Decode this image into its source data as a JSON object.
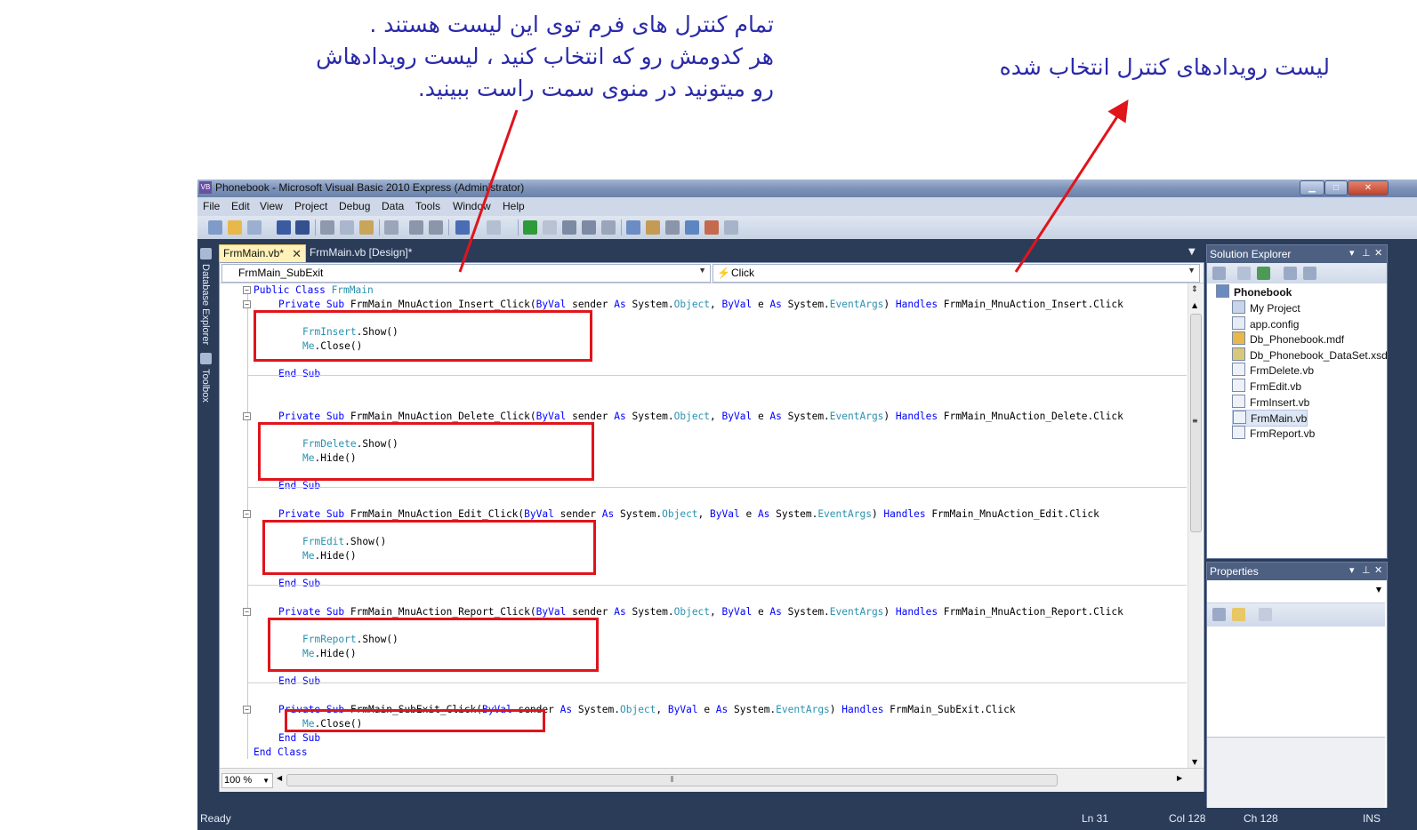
{
  "annotations": {
    "left_line1": "تمام کنترل های فرم توی این لیست هستند .",
    "left_line2": "هر کدومش رو که انتخاب کنید ، لیست رویدادهاش",
    "left_line3": "رو میتونید در منوی سمت راست ببینید.",
    "right_text": "لیست رویدادهای کنترل انتخاب شده"
  },
  "window": {
    "icon": "VB",
    "title": "Phonebook - Microsoft Visual Basic 2010 Express (Administrator)"
  },
  "menu": [
    "File",
    "Edit",
    "View",
    "Project",
    "Debug",
    "Data",
    "Tools",
    "Window",
    "Help"
  ],
  "left_tabs": {
    "database_explorer": "Database Explorer",
    "toolbox": "Toolbox"
  },
  "tabs": [
    {
      "label": "FrmMain.vb*",
      "close": "✕"
    },
    {
      "label": "FrmMain.vb [Design]*"
    }
  ],
  "navbar": {
    "object": "FrmMain_SubExit",
    "event": "Click"
  },
  "code": {
    "class_decl": [
      "Public Class ",
      "FrmMain"
    ],
    "end_class": "End Class",
    "end_sub": "End Sub",
    "subs": [
      {
        "kw": "Private Sub ",
        "name": "FrmMain_MnuAction_Insert_Click",
        "handles": "FrmMain_MnuAction_Insert.Click",
        "form": "FrmInsert",
        "action": "Close"
      },
      {
        "kw": "Private Sub ",
        "name": "FrmMain_MnuAction_Delete_Click",
        "handles": "FrmMain_MnuAction_Delete.Click",
        "form": "FrmDelete",
        "action": "Hide"
      },
      {
        "kw": "Private Sub ",
        "name": "FrmMain_MnuAction_Edit_Click",
        "handles": "FrmMain_MnuAction_Edit.Click",
        "form": "FrmEdit",
        "action": "Hide"
      },
      {
        "kw": "Private Sub ",
        "name": "FrmMain_MnuAction_Report_Click",
        "handles": "FrmMain_MnuAction_Report.Click",
        "form": "FrmReport",
        "action": "Hide"
      },
      {
        "kw": "Private Sub ",
        "name": "FrmMain_SubExit_Click",
        "handles": "FrmMain_SubExit.Click",
        "action": "Close"
      }
    ],
    "params": {
      "p1": "(",
      "byval": "ByVal",
      "sender": " sender ",
      "as": "As",
      "system": " System.",
      "object": "Object",
      "comma": ", ",
      "e": " e ",
      "eventargs": "EventArgs",
      "close_paren": ") ",
      "handles": "Handles "
    },
    "show_call": ".Show()",
    "me": "Me",
    "close_call": ".Close()",
    "hide_call": ".Hide()"
  },
  "zoom": "100 %",
  "solution_explorer": {
    "title": "Solution Explorer",
    "project": "Phonebook",
    "items": [
      "My Project",
      "app.config",
      "Db_Phonebook.mdf",
      "Db_Phonebook_DataSet.xsd",
      "FrmDelete.vb",
      "FrmEdit.vb",
      "FrmInsert.vb",
      "FrmMain.vb",
      "FrmReport.vb"
    ],
    "selected": "FrmMain.vb"
  },
  "properties": {
    "title": "Properties"
  },
  "status": {
    "ready": "Ready",
    "ln": "Ln 31",
    "col": "Col 128",
    "ch": "Ch 128",
    "ins": "INS"
  },
  "colors": {
    "annotation": "#2a2aa8",
    "arrow": "#e0141b",
    "keyword": "#0000ff",
    "type": "#2b91af",
    "ide_frame": "#2b3c59"
  }
}
